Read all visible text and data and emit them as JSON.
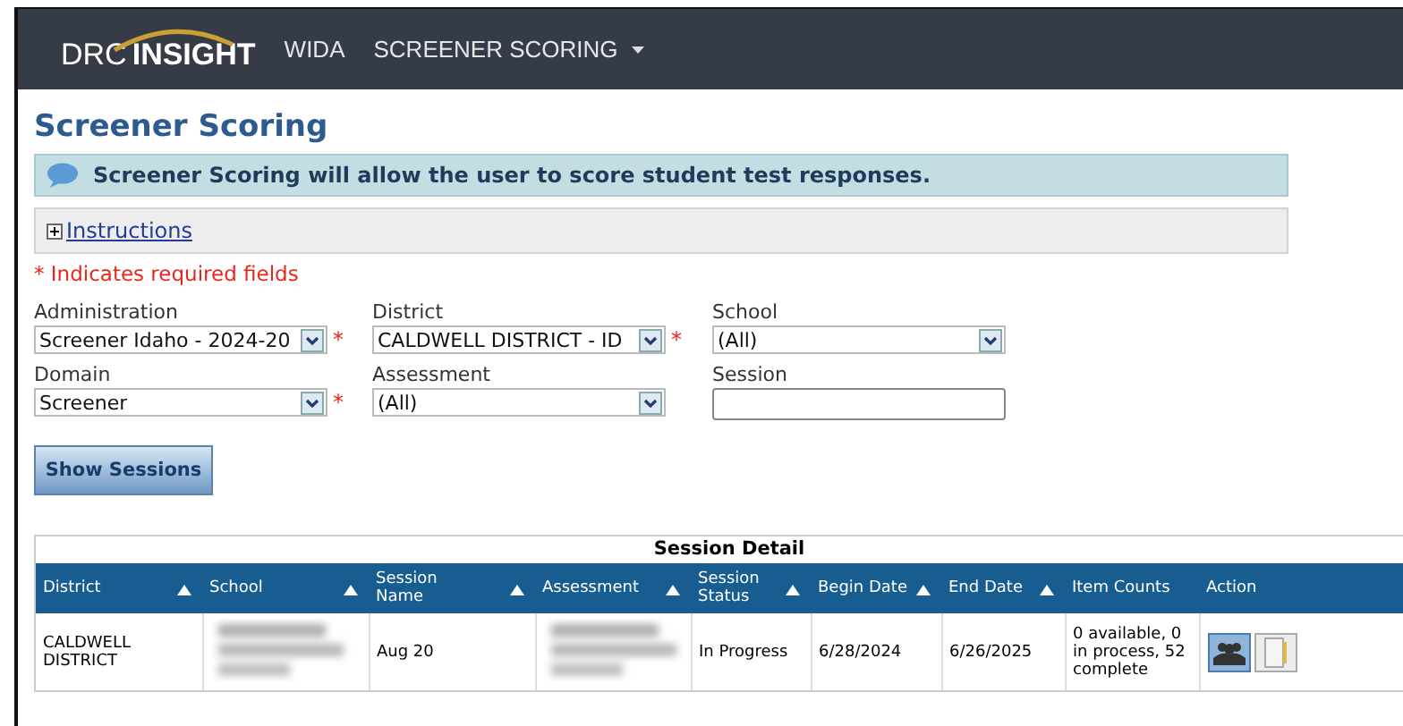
{
  "nav": {
    "logo": {
      "part_1": "DRC",
      "part_2": "INSIGHT"
    },
    "items": [
      {
        "label": "WIDA",
        "dropdown": false
      },
      {
        "label": "SCREENER SCORING",
        "dropdown": true
      }
    ]
  },
  "page_title": "Screener Scoring",
  "info_message": "Screener Scoring will allow the user to score student test responses.",
  "instructions": {
    "label": "Instructions",
    "expanded": false
  },
  "required_note": "* Indicates required fields",
  "filters": [
    {
      "label": "Administration",
      "kind": "select",
      "value": "Screener Idaho - 2024-20",
      "required": true
    },
    {
      "label": "District",
      "kind": "select",
      "value": "CALDWELL DISTRICT - ID",
      "required": true
    },
    {
      "label": "School",
      "kind": "select",
      "value": "(All)",
      "required": false
    },
    {
      "label": "Domain",
      "kind": "select",
      "value": "Screener",
      "required": true
    },
    {
      "label": "Assessment",
      "kind": "select",
      "value": "(All)",
      "required": false
    },
    {
      "label": "Session",
      "kind": "text",
      "required": false
    }
  ],
  "required_mark": "*",
  "show_button": "Show Sessions",
  "table": {
    "title": "Session Detail",
    "columns": [
      {
        "label": "District",
        "sortable": true
      },
      {
        "label": "School",
        "sortable": true
      },
      {
        "label": "Session Name",
        "sortable": true
      },
      {
        "label": "Assessment",
        "sortable": true
      },
      {
        "label": "Session Status",
        "sortable": true
      },
      {
        "label": "Begin Date",
        "sortable": true
      },
      {
        "label": "End Date",
        "sortable": true
      },
      {
        "label": "Item Counts",
        "sortable": false
      },
      {
        "label": "Action",
        "sortable": false
      }
    ],
    "rows": [
      {
        "cells": [
          {
            "kind": "text",
            "text": "CALDWELL DISTRICT"
          },
          {
            "kind": "blurred"
          },
          {
            "kind": "text",
            "text": "Aug 20"
          },
          {
            "kind": "blurred"
          },
          {
            "kind": "text",
            "text": "In Progress"
          },
          {
            "kind": "text",
            "text": "6/28/2024"
          },
          {
            "kind": "text",
            "text": "6/26/2025"
          },
          {
            "kind": "text",
            "text": "0 available, 0 in process, 52 complete"
          },
          {
            "kind": "actions"
          }
        ]
      }
    ]
  }
}
